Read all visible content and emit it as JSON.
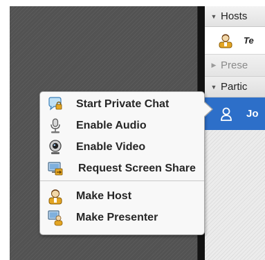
{
  "attendee_pod": {
    "hosts_header": "Hosts",
    "host_name": "Te",
    "presenters_header": "Prese",
    "participants_header": "Partic",
    "participant_name": "Jo"
  },
  "context_menu": {
    "items": [
      {
        "label": "Start Private Chat",
        "icon": "private-chat-icon"
      },
      {
        "label": "Enable Audio",
        "icon": "microphone-icon"
      },
      {
        "label": "Enable Video",
        "icon": "webcam-icon"
      },
      {
        "label": "Request Screen Share",
        "icon": "screen-share-icon"
      },
      {
        "label": "Make Host",
        "icon": "host-icon"
      },
      {
        "label": "Make Presenter",
        "icon": "presenter-icon"
      }
    ]
  },
  "colors": {
    "selection": "#2d6fc9",
    "divider": "#121212",
    "host_badge": "#e3a524"
  }
}
